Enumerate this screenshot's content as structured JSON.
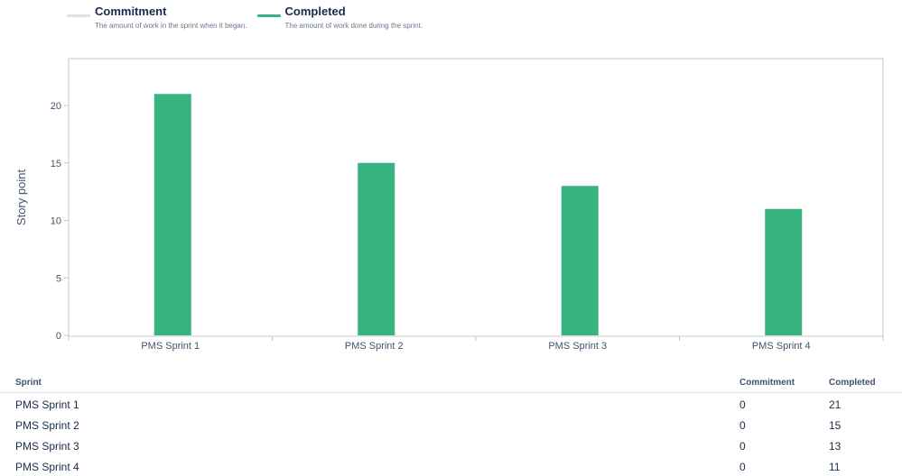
{
  "legend": [
    {
      "name": "Commitment",
      "description": "The amount of work in the sprint when it began.",
      "color": "#dfe1e6"
    },
    {
      "name": "Completed",
      "description": "The amount of work done during the sprint.",
      "color": "#36b37e"
    }
  ],
  "chart_data": {
    "type": "bar",
    "title": "",
    "xlabel": "",
    "ylabel": "Story point",
    "ylim": [
      0,
      24
    ],
    "yticks": [
      0,
      5,
      10,
      15,
      20
    ],
    "grid": false,
    "categories": [
      "PMS Sprint 1",
      "PMS Sprint 2",
      "PMS Sprint 3",
      "PMS Sprint 4"
    ],
    "series": [
      {
        "name": "Commitment",
        "values": [
          0,
          0,
          0,
          0
        ],
        "color": "#dfe1e6"
      },
      {
        "name": "Completed",
        "values": [
          21,
          15,
          13,
          11
        ],
        "color": "#36b37e"
      }
    ]
  },
  "table": {
    "headers": {
      "sprint": "Sprint",
      "commitment": "Commitment",
      "completed": "Completed"
    },
    "rows": [
      {
        "sprint": "PMS Sprint 1",
        "commitment": "0",
        "completed": "21"
      },
      {
        "sprint": "PMS Sprint 2",
        "commitment": "0",
        "completed": "15"
      },
      {
        "sprint": "PMS Sprint 3",
        "commitment": "0",
        "completed": "13"
      },
      {
        "sprint": "PMS Sprint 4",
        "commitment": "0",
        "completed": "11"
      }
    ]
  }
}
